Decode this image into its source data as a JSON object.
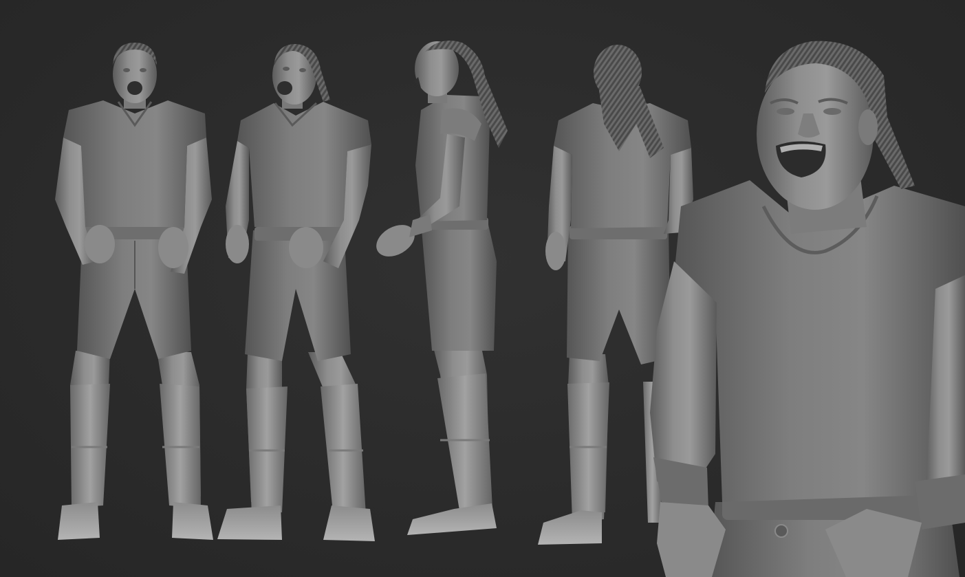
{
  "scene": {
    "kind": "3d-sculpt-turnaround-render",
    "background_color": "#2b2b2b",
    "material_color": "#8a8a8a",
    "views": [
      {
        "view": "front"
      },
      {
        "view": "three-quarter-front"
      },
      {
        "view": "side"
      },
      {
        "view": "back"
      },
      {
        "view": "close-up-bust"
      }
    ]
  }
}
